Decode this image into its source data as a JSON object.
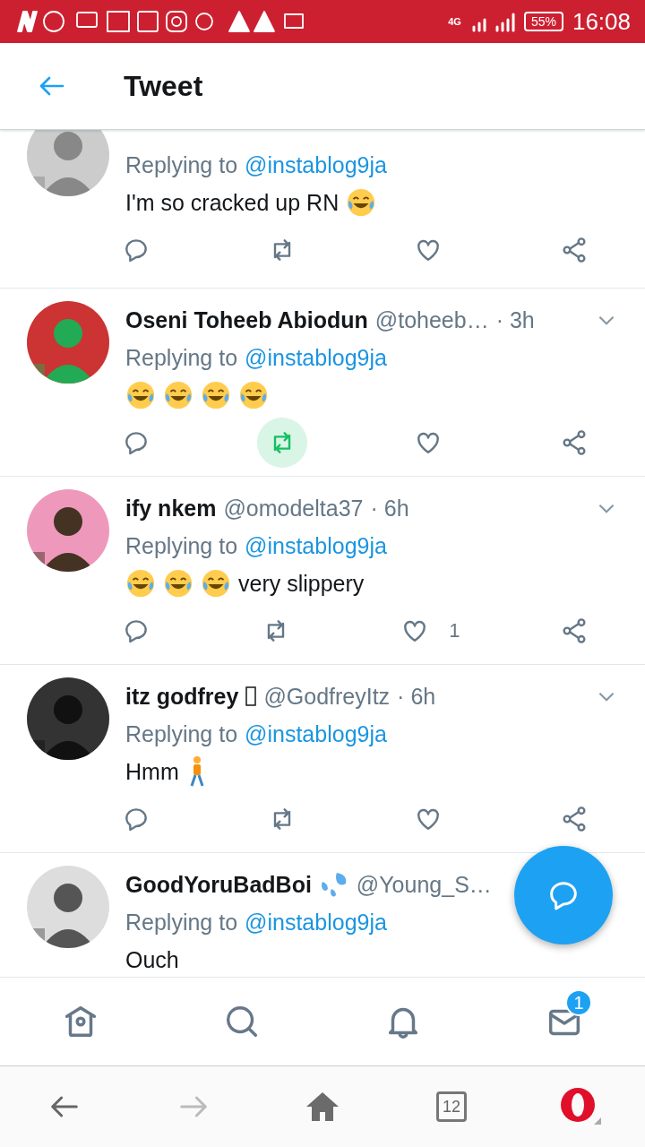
{
  "status_bar": {
    "network": "4G",
    "battery": "55%",
    "time": "16:08"
  },
  "header": {
    "title": "Tweet"
  },
  "tweets": [
    {
      "reply_label": "Replying to",
      "reply_to": "@instablog9ja",
      "body": [
        {
          "kind": "text",
          "text": "I'm so cracked up RN"
        },
        {
          "kind": "laugh"
        }
      ],
      "actions": [
        {
          "kind": "reply",
          "active": false
        },
        {
          "kind": "retweet",
          "active": false
        },
        {
          "kind": "like",
          "active": false
        },
        {
          "kind": "share",
          "active": false
        }
      ]
    },
    {
      "name": [
        {
          "kind": "text",
          "text": "Oseni Toheeb Abiodun"
        }
      ],
      "handle": "@toheeb…",
      "time": "· 3h",
      "reply_label": "Replying to",
      "reply_to": "@instablog9ja",
      "body": [
        {
          "kind": "laugh"
        },
        {
          "kind": "laugh"
        },
        {
          "kind": "laugh"
        },
        {
          "kind": "laugh"
        }
      ],
      "actions": [
        {
          "kind": "reply",
          "active": false
        },
        {
          "kind": "retweet",
          "active": true
        },
        {
          "kind": "like",
          "active": false
        },
        {
          "kind": "share",
          "active": false
        }
      ]
    },
    {
      "name": [
        {
          "kind": "text",
          "text": "ify nkem"
        }
      ],
      "handle": "@omodelta37",
      "time": "· 6h",
      "reply_label": "Replying to",
      "reply_to": "@instablog9ja",
      "body": [
        {
          "kind": "laugh"
        },
        {
          "kind": "laugh"
        },
        {
          "kind": "laugh"
        },
        {
          "kind": "text",
          "text": "very slippery"
        }
      ],
      "actions": [
        {
          "kind": "reply",
          "active": false
        },
        {
          "kind": "retweet",
          "active": false
        },
        {
          "kind": "like",
          "active": false,
          "count": "1"
        },
        {
          "kind": "share",
          "active": false
        }
      ]
    },
    {
      "name": [
        {
          "kind": "text",
          "text": "itz godfrey"
        },
        {
          "kind": "missing"
        }
      ],
      "handle": "@GodfreyItz",
      "time": "· 6h",
      "reply_label": "Replying to",
      "reply_to": "@instablog9ja",
      "body": [
        {
          "kind": "text",
          "text": "Hmm"
        },
        {
          "kind": "walk"
        }
      ],
      "actions": [
        {
          "kind": "reply",
          "active": false
        },
        {
          "kind": "retweet",
          "active": false
        },
        {
          "kind": "like",
          "active": false
        },
        {
          "kind": "share",
          "active": false
        }
      ]
    },
    {
      "name": [
        {
          "kind": "text",
          "text": "GoodYoruBadBoi"
        },
        {
          "kind": "drops"
        }
      ],
      "handle": "@Young_S…",
      "reply_label": "Replying to",
      "reply_to": "@instablog9ja",
      "body": [
        {
          "kind": "text",
          "text": "Ouch"
        }
      ]
    }
  ],
  "tab_bar": [
    {
      "kind": "home",
      "selected": false
    },
    {
      "kind": "search",
      "selected": false
    },
    {
      "kind": "bell",
      "selected": false
    },
    {
      "kind": "mail",
      "selected": false,
      "badge": "1"
    }
  ],
  "browser_bar": {
    "tabs_count": "12"
  }
}
